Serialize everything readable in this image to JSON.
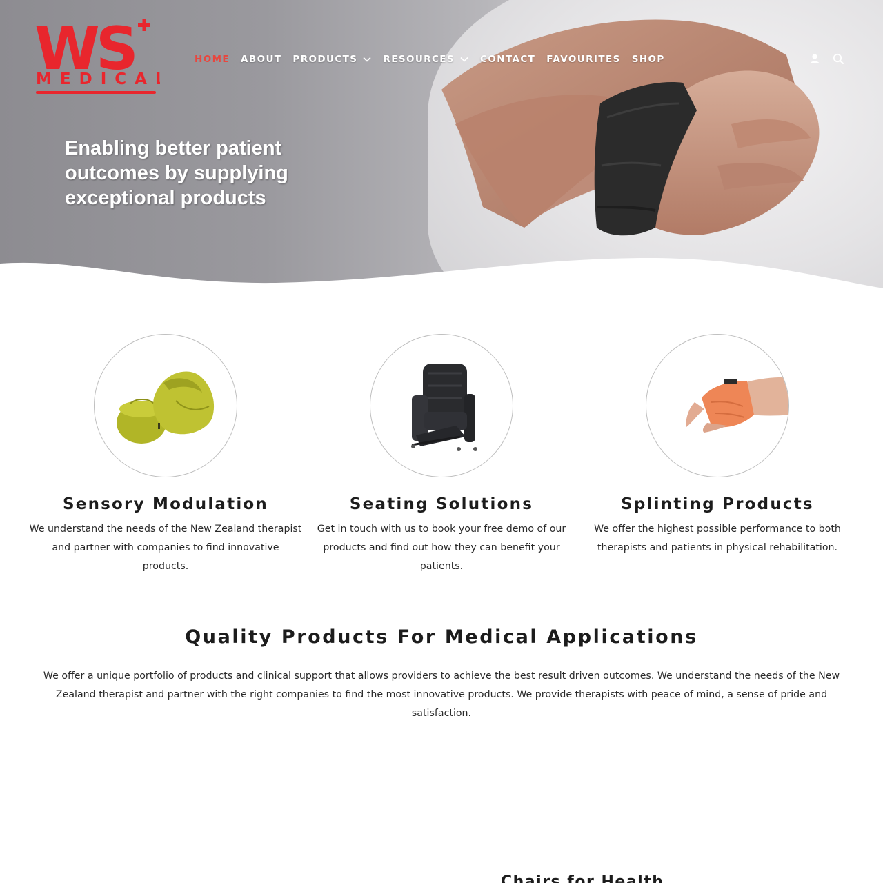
{
  "brand": {
    "logo_text_top": "WS",
    "logo_text_bottom": "MEDICAL",
    "accent_color": "#e8262d",
    "nav_active_color": "#e8473f"
  },
  "nav": {
    "items": [
      {
        "label": "HOME",
        "active": true,
        "has_dropdown": false
      },
      {
        "label": "ABOUT",
        "active": false,
        "has_dropdown": false
      },
      {
        "label": "PRODUCTS",
        "active": false,
        "has_dropdown": true
      },
      {
        "label": "RESOURCES",
        "active": false,
        "has_dropdown": true
      },
      {
        "label": "CONTACT",
        "active": false,
        "has_dropdown": false
      },
      {
        "label": "FAVOURITES",
        "active": false,
        "has_dropdown": false
      },
      {
        "label": "SHOP",
        "active": false,
        "has_dropdown": false
      }
    ],
    "icons": [
      "account-icon",
      "search-icon"
    ]
  },
  "hero": {
    "tagline_lines": [
      "Enabling better patient",
      "outcomes by supplying",
      "exceptional products"
    ]
  },
  "features": [
    {
      "title": "Sensory Modulation",
      "text": "We understand the needs of the New Zealand therapist and partner with companies to find innovative products.",
      "image": "bean-bag-image"
    },
    {
      "title": "Seating Solutions",
      "text": "Get in touch with us to book your free demo of our products and find out how they can benefit your patients.",
      "image": "recliner-chair-image"
    },
    {
      "title": "Splinting Products",
      "text": "We offer the highest possible performance to both therapists and patients in physical rehabilitation.",
      "image": "hand-splint-image"
    }
  ],
  "quality": {
    "title": "Quality Products For Medical Applications",
    "text": "We offer a unique portfolio of products and clinical support that allows providers to achieve the best result driven outcomes. We understand the needs of the New Zealand therapist and partner with the right companies to find the most innovative products. We provide therapists with peace of mind, a sense of pride and satisfaction."
  },
  "next_section": {
    "title_partial": "Chairs for Health"
  }
}
